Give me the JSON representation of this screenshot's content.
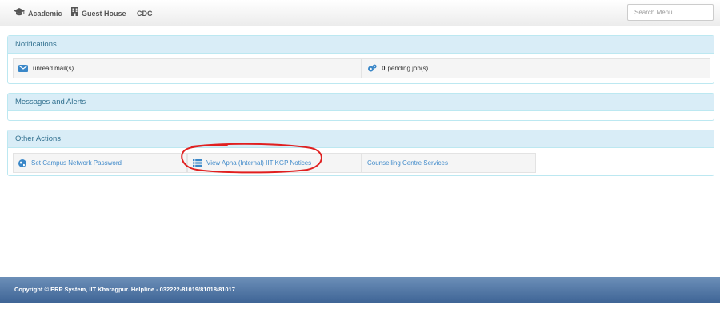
{
  "navbar": {
    "items": [
      {
        "label": "Academic",
        "icon": "graduation-cap-icon"
      },
      {
        "label": "Guest House",
        "icon": "building-icon"
      },
      {
        "label": "CDC",
        "icon": ""
      }
    ],
    "search_placeholder": "Search Menu"
  },
  "notifications": {
    "title": "Notifications",
    "mail_text": "unread mail(s)",
    "jobs_count": "0",
    "jobs_text": "pending job(s)"
  },
  "messages": {
    "title": "Messages and Alerts"
  },
  "other_actions": {
    "title": "Other Actions",
    "links": [
      {
        "label": "Set Campus Network Password",
        "icon": "globe-icon"
      },
      {
        "label": "View Apna (Internal) IIT KGP Notices",
        "icon": "list-icon"
      },
      {
        "label": "Counselling Centre Services",
        "icon": ""
      }
    ]
  },
  "footer": {
    "text": "Copyright © ERP System, IIT Kharagpur. Helpline - 032222-81019/81018/81017"
  },
  "colors": {
    "panel_heading_bg": "#d9edf7",
    "panel_heading_text": "#31708f",
    "link": "#428bca",
    "footer_bg": "#4a6fa0",
    "annotation": "#e02020"
  }
}
